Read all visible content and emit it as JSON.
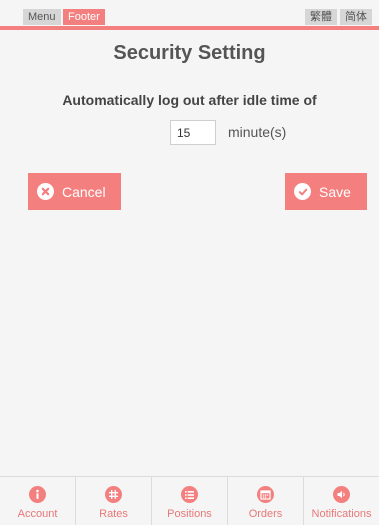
{
  "top_bar": {
    "menu_label": "Menu",
    "footer_label": "Footer",
    "traditional_label": "繁體",
    "simplified_label": "简体"
  },
  "main": {
    "title": "Security Setting",
    "subtitle": "Automatically log out after idle time of",
    "idle_value": "15",
    "unit_label": "minute(s)"
  },
  "actions": {
    "cancel_label": "Cancel",
    "save_label": "Save"
  },
  "footer_nav": {
    "items": [
      {
        "label": "Account",
        "icon": "info-icon"
      },
      {
        "label": "Rates",
        "icon": "grid-icon"
      },
      {
        "label": "Positions",
        "icon": "list-icon"
      },
      {
        "label": "Orders",
        "icon": "calendar-icon"
      },
      {
        "label": "Notifications",
        "icon": "speaker-icon"
      }
    ]
  },
  "colors": {
    "accent": "#f47f7f",
    "background": "#f5f5f5"
  }
}
